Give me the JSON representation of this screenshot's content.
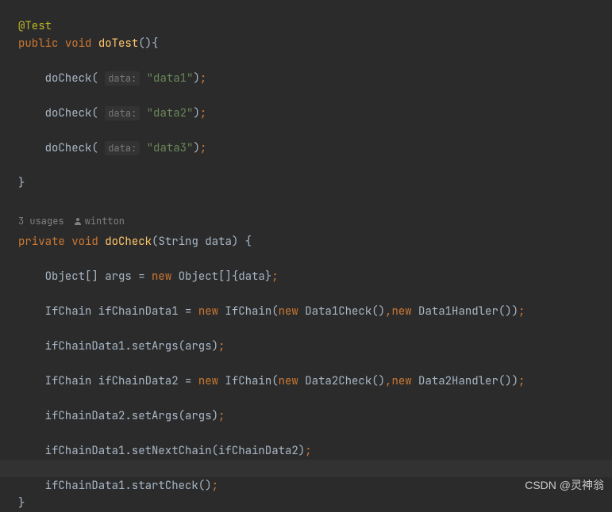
{
  "code": {
    "line1_annotation": "@Test",
    "line2_public": "public",
    "line2_void": "void",
    "line2_method": "doTest",
    "line2_params": "(){",
    "line3_method": "doCheck(",
    "line3_hint": "data:",
    "line3_string": "\"data1\"",
    "line3_end": ")",
    "line3_semi": ";",
    "line4_method": "doCheck(",
    "line4_hint": "data:",
    "line4_string": "\"data2\"",
    "line4_end": ")",
    "line4_semi": ";",
    "line5_method": "doCheck(",
    "line5_hint": "data:",
    "line5_string": "\"data3\"",
    "line5_end": ")",
    "line5_semi": ";",
    "line6_brace": "}",
    "usages_text": "3 usages",
    "author_text": "wintton",
    "line7_private": "private",
    "line7_void": "void",
    "line7_method": "doCheck",
    "line7_params": "(String data) {",
    "line8_a": "Object[] args = ",
    "line8_new": "new",
    "line8_b": " Object[]{data}",
    "line8_semi": ";",
    "line9_a": "IfChain ifChainData1 = ",
    "line9_new1": "new",
    "line9_b": " IfChain(",
    "line9_new2": "new",
    "line9_c": " Data1Check()",
    "line9_comma1": ",",
    "line9_new3": "new",
    "line9_d": " Data1Handler())",
    "line9_semi": ";",
    "line10_a": "ifChainData1.setArgs(args)",
    "line10_semi": ";",
    "line11_a": "IfChain ifChainData2 = ",
    "line11_new1": "new",
    "line11_b": " IfChain(",
    "line11_new2": "new",
    "line11_c": " Data2Check()",
    "line11_comma1": ",",
    "line11_new3": "new",
    "line11_d": " Data2Handler())",
    "line11_semi": ";",
    "line12_a": "ifChainData2.setArgs(args)",
    "line12_semi": ";",
    "line13_a": "ifChainData1.setNextChain(ifChainData2)",
    "line13_semi": ";",
    "line14_a": "ifChainData1.startCheck()",
    "line14_semi": ";",
    "line15_brace": "}"
  },
  "watermark": "CSDN @灵神翁"
}
